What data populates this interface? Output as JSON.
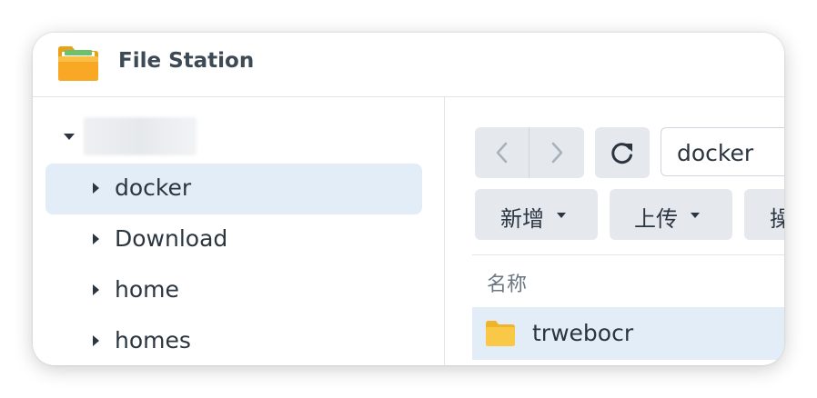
{
  "window": {
    "title": "File Station",
    "icon": "folder-app-icon"
  },
  "sidebar": {
    "root": {
      "label": "",
      "expanded": true
    },
    "items": [
      {
        "label": "docker",
        "selected": true
      },
      {
        "label": "Download",
        "selected": false
      },
      {
        "label": "home",
        "selected": false
      },
      {
        "label": "homes",
        "selected": false
      }
    ]
  },
  "toolbar": {
    "path": "docker",
    "create_label": "新增",
    "upload_label": "上传",
    "action_label": "操"
  },
  "file_list": {
    "name_header": "名称",
    "rows": [
      {
        "name": "trwebocr",
        "type": "folder",
        "selected": true
      }
    ]
  },
  "colors": {
    "selected_bg": "#e3edf8",
    "button_bg": "#e5e9ee",
    "folder_yellow": "#f7c23a"
  }
}
